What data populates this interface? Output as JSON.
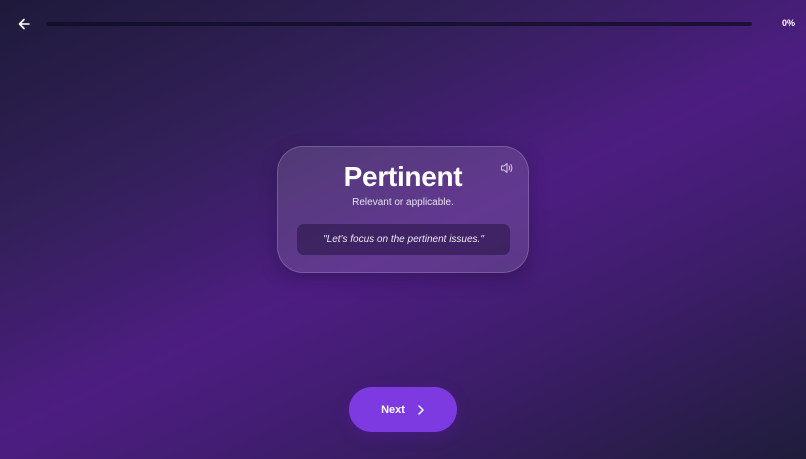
{
  "header": {
    "back_icon": "arrow-left-icon",
    "progress_percent": 0,
    "progress_label": "0%"
  },
  "card": {
    "speaker_icon": "speaker-icon",
    "word": "Pertinent",
    "definition": "Relevant or applicable.",
    "example": "\"Let's focus on the pertinent issues.\""
  },
  "footer": {
    "next_label": "Next",
    "next_icon": "chevron-right-icon"
  },
  "colors": {
    "accent": "#7c3ae0",
    "background_mid": "#4d1d82",
    "background_dark": "#1e1a3a"
  }
}
